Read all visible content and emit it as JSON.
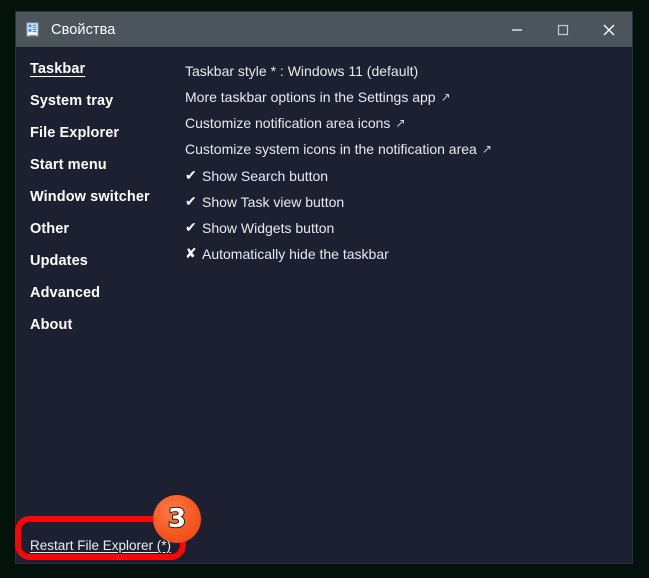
{
  "window": {
    "title": "Свойства",
    "icon": "properties-document-icon",
    "controls": {
      "minimize": "—",
      "maximize": "□",
      "close": "✕"
    }
  },
  "sidebar": {
    "items": [
      {
        "label": "Taskbar",
        "active": true
      },
      {
        "label": "System tray",
        "active": false
      },
      {
        "label": "File Explorer",
        "active": false
      },
      {
        "label": "Start menu",
        "active": false
      },
      {
        "label": "Window switcher",
        "active": false
      },
      {
        "label": "Other",
        "active": false
      },
      {
        "label": "Updates",
        "active": false
      },
      {
        "label": "Advanced",
        "active": false
      },
      {
        "label": "About",
        "active": false
      }
    ]
  },
  "main": {
    "rows": [
      {
        "mark": "",
        "label": "Taskbar style * : Windows 11 (default)",
        "arrow": "",
        "type": "setting"
      },
      {
        "mark": "",
        "label": "More taskbar options in the Settings app",
        "arrow": "↗",
        "type": "link"
      },
      {
        "mark": "",
        "label": "Customize notification area icons",
        "arrow": "↗",
        "type": "link"
      },
      {
        "mark": "",
        "label": "Customize system icons in the notification area",
        "arrow": "↗",
        "type": "link"
      },
      {
        "mark": "✔",
        "label": "Show Search button",
        "arrow": "",
        "type": "checkbox-on"
      },
      {
        "mark": "✔",
        "label": "Show Task view button",
        "arrow": "",
        "type": "checkbox-on"
      },
      {
        "mark": "✔",
        "label": "Show Widgets button",
        "arrow": "",
        "type": "checkbox-on"
      },
      {
        "mark": "✘",
        "label": "Automatically hide the taskbar",
        "arrow": "",
        "type": "checkbox-off"
      }
    ]
  },
  "footer": {
    "restart_link": "Restart File Explorer (*)"
  },
  "annotation": {
    "badge_number": "3",
    "badge_color": "#f4541c",
    "highlight_color": "#fb0505"
  },
  "colors": {
    "titlebar": "#4c545c",
    "window_body": "#1c2030",
    "desktop": "#04120c",
    "text": "#ffffff"
  }
}
